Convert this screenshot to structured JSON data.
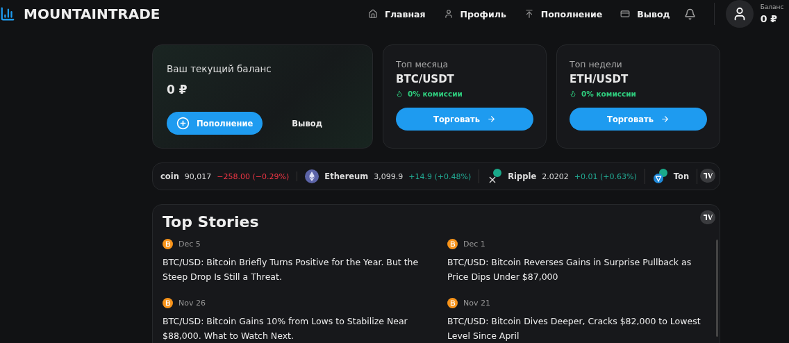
{
  "brand": {
    "name": "MOUNTAINTRADE"
  },
  "nav": [
    {
      "label": "Главная"
    },
    {
      "label": "Профиль"
    },
    {
      "label": "Пополнение"
    },
    {
      "label": "Вывод"
    }
  ],
  "account": {
    "label": "Баланс",
    "value": "0 ₽"
  },
  "balance_card": {
    "title": "Ваш текущий баланс",
    "amount": "0 ₽",
    "deposit_button": "Пополнение",
    "withdraw_button": "Вывод"
  },
  "top_cards": [
    {
      "label": "Топ месяца",
      "pair": "BTC/USDT",
      "fee": "0% комиссии",
      "button": "Торговать"
    },
    {
      "label": "Топ недели",
      "pair": "ETH/USDT",
      "fee": "0% комиссии",
      "button": "Торговать"
    }
  ],
  "ticker": [
    {
      "name": "coin",
      "price": "90,017",
      "change": "−258.00 (−0.29%)",
      "color": "#f23645"
    },
    {
      "name": "Ethereum",
      "price": "3,099.9",
      "change": "+14.9 (+0.48%)",
      "color": "#22ab94"
    },
    {
      "name": "Ripple",
      "price": "2.0202",
      "change": "+0.01 (+0.63%)",
      "color": "#22ab94"
    },
    {
      "name": "Ton"
    }
  ],
  "top_stories": {
    "title": "Top Stories",
    "items": [
      {
        "date": "Dec 5",
        "headline": "BTC/USD: Bitcoin Briefly Turns Positive for the Year. But the Steep Drop Is Still a Threat."
      },
      {
        "date": "Dec 1",
        "headline": "BTC/USD: Bitcoin Reverses Gains in Surprise Pullback as Price Dips Under $87,000"
      },
      {
        "date": "Nov 26",
        "headline": "BTC/USD: Bitcoin Gains 10% from Lows to Stabilize Near $88,000. What to Watch Next."
      },
      {
        "date": "Nov 21",
        "headline": "BTC/USD: Bitcoin Dives Deeper, Cracks $82,000 to Lowest Level Since April"
      }
    ]
  }
}
